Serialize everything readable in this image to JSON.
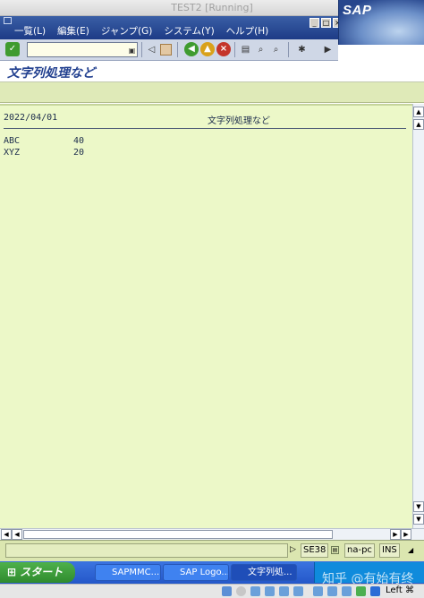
{
  "window": {
    "title": "TEST2 [Running]"
  },
  "menu": {
    "items": [
      "一覧(L)",
      "編集(E)",
      "ジャンプ(G)",
      "システム(Y)",
      "ヘルプ(H)"
    ],
    "logo": "SAP"
  },
  "toolbar": {
    "command_value": ""
  },
  "screen": {
    "title": "文字列処理など"
  },
  "list": {
    "date": "2022/04/01",
    "heading": "文字列処理など",
    "rows": [
      {
        "name": "ABC",
        "value": "40"
      },
      {
        "name": "XYZ",
        "value": "20"
      }
    ]
  },
  "status": {
    "transaction": "SE38",
    "server": "na-pc",
    "mode": "INS"
  },
  "taskbar": {
    "start_label": "スタート",
    "tasks": [
      "SAPMMC...",
      "SAP Logo...",
      "文字列処..."
    ]
  },
  "watermark": "知乎 @有始有终",
  "bottom": {
    "key_label": "Left ⌘"
  },
  "colors": {
    "menubar": "#1d3b86",
    "list_background": "#ecf8c8",
    "title_text": "#22408f"
  }
}
